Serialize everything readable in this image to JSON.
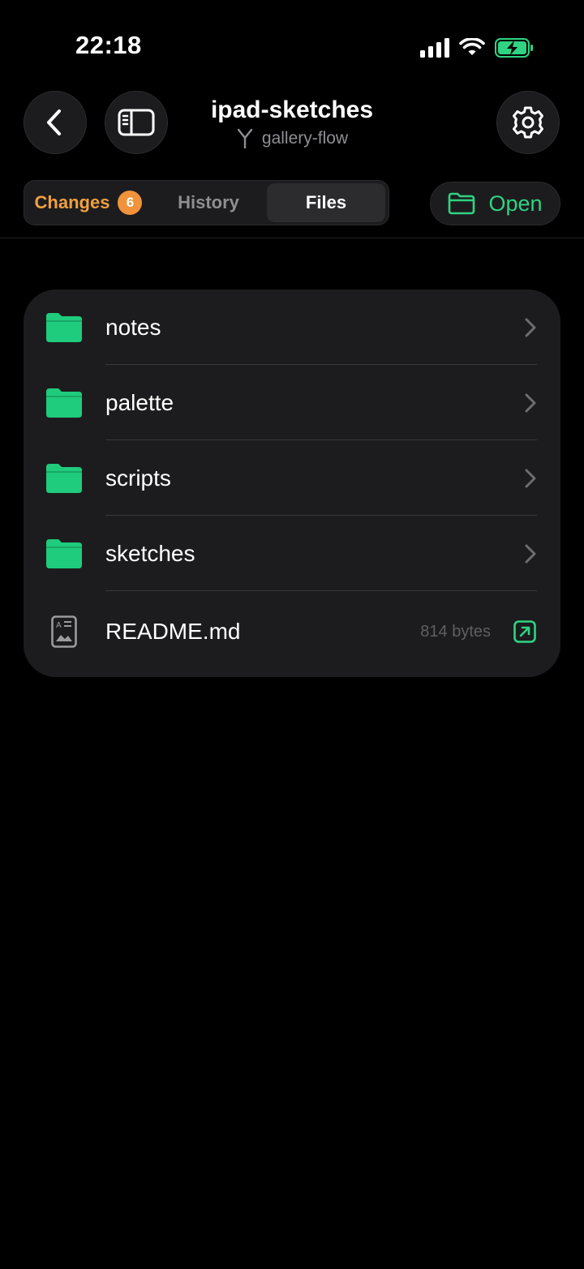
{
  "status_bar": {
    "time": "22:18"
  },
  "header": {
    "title": "ipad-sketches",
    "branch": "gallery-flow"
  },
  "tabs": [
    {
      "label": "Changes",
      "badge": "6",
      "active": false
    },
    {
      "label": "History",
      "active": false
    },
    {
      "label": "Files",
      "active": true
    }
  ],
  "open_button": {
    "label": "Open"
  },
  "files": [
    {
      "name": "notes",
      "type": "folder"
    },
    {
      "name": "palette",
      "type": "folder"
    },
    {
      "name": "scripts",
      "type": "folder"
    },
    {
      "name": "sketches",
      "type": "folder"
    },
    {
      "name": "README.md",
      "type": "file",
      "size": "814 bytes"
    }
  ],
  "colors": {
    "accent_green": "#2fd382",
    "accent_orange": "#f0a040",
    "card_bg": "#1c1c1e",
    "background": "#000000"
  }
}
